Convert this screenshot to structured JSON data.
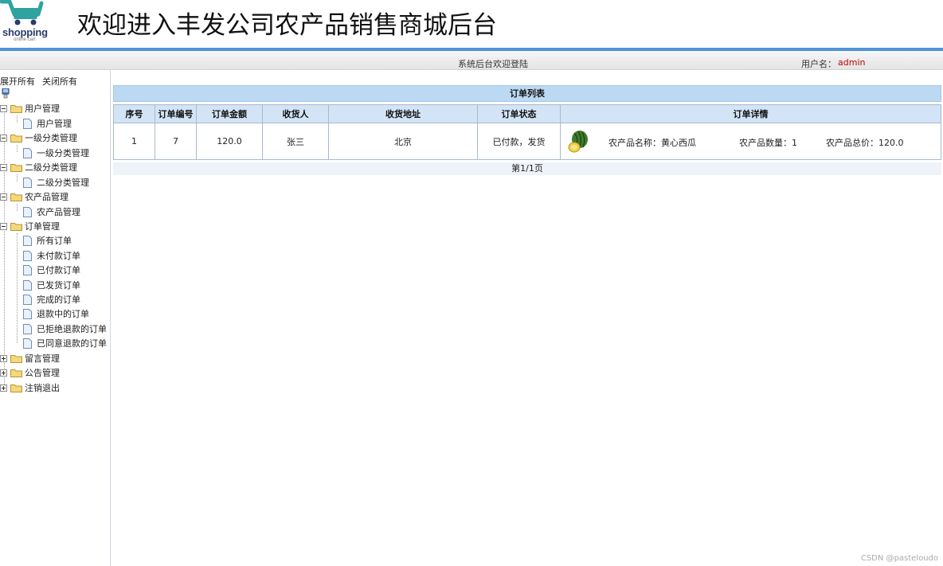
{
  "header": {
    "logo_text": "shopping",
    "logo_sub": "online cart",
    "title": "欢迎进入丰发公司农产品销售商城后台"
  },
  "statusbar": {
    "welcome": "系统后台欢迎登陆",
    "user_label": "用户名：",
    "user_name": "admin"
  },
  "sidebar": {
    "expand_all": "展开所有",
    "collapse_all": "关闭所有",
    "groups": [
      {
        "label": "用户管理",
        "children": [
          "用户管理"
        ]
      },
      {
        "label": "一级分类管理",
        "children": [
          "一级分类管理"
        ]
      },
      {
        "label": "二级分类管理",
        "children": [
          "二级分类管理"
        ]
      },
      {
        "label": "农产品管理",
        "children": [
          "农产品管理"
        ]
      },
      {
        "label": "订单管理",
        "children": [
          "所有订单",
          "未付款订单",
          "已付款订单",
          "已发货订单",
          "完成的订单",
          "退款中的订单",
          "已拒绝退款的订单",
          "已同意退款的订单"
        ]
      },
      {
        "label": "留言管理",
        "children": []
      },
      {
        "label": "公告管理",
        "children": []
      },
      {
        "label": "注销退出",
        "children": []
      }
    ]
  },
  "main": {
    "list_title": "订单列表",
    "columns": [
      "序号",
      "订单编号",
      "订单金额",
      "收货人",
      "收货地址",
      "订单状态",
      "订单详情"
    ],
    "rows": [
      {
        "index": "1",
        "order_no": "7",
        "amount": "120.0",
        "receiver": "张三",
        "address": "北京",
        "status": "已付款，发货",
        "product_name": "农产品名称：黄心西瓜",
        "product_qty": "农产品数量：1",
        "product_total": "农产品总价：120.0"
      }
    ],
    "pager": "第1/1页"
  },
  "watermark": "CSDN @pasteloudo",
  "colors": {
    "header_line": "#4f93d8",
    "title_bar": "#bcd9f3",
    "table_header": "#d2e4f6",
    "username": "#c00000"
  }
}
